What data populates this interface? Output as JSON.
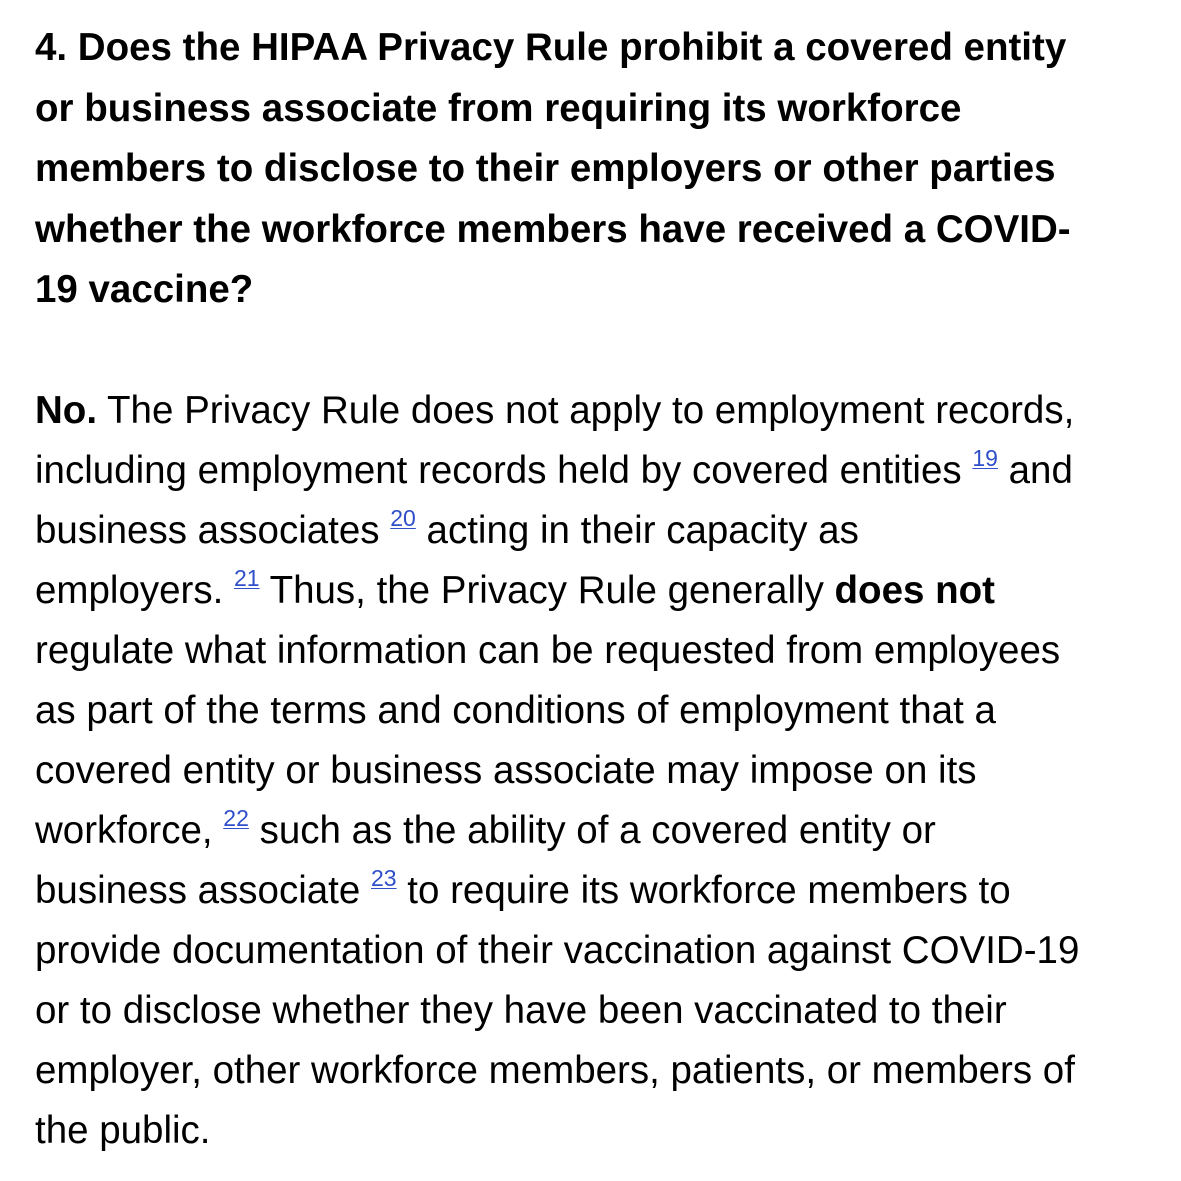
{
  "question": {
    "lines": [
      "4. Does the HIPAA Privacy Rule prohibit a covered entity",
      "or business associate from requiring its workforce",
      "members to disclose to their employers or other parties",
      "whether the workforce members have received a COVID-",
      "19 vaccine?"
    ]
  },
  "answer": {
    "lead": "No.",
    "l1": " The Privacy Rule does not apply to employment records,",
    "l2a": "including employment records held by covered entities ",
    "fn19": "19",
    "l2b": " and",
    "l3a": "business associates ",
    "fn20": "20",
    "l3b": " acting in their capacity as",
    "l4a": "employers. ",
    "fn21": "21",
    "l4b": " Thus, the Privacy Rule generally ",
    "l4bold": "does not",
    "l5": "regulate what information can be requested from employees",
    "l6": "as part of the terms and conditions of employment that a",
    "l7": "covered entity or business associate may impose on its",
    "l8a": "workforce, ",
    "fn22": "22",
    "l8b": " such as the ability of a covered entity or",
    "l9a": "business associate ",
    "fn23": "23",
    "l9b": " to require its workforce members to",
    "l10": "provide documentation of their vaccination against COVID-19",
    "l11": "or to disclose whether they have been vaccinated to their",
    "l12": "employer, other workforce members, patients, or members of",
    "l13": "the public."
  },
  "colors": {
    "text": "#000000",
    "link": "#2f4fc9",
    "background": "#ffffff"
  }
}
